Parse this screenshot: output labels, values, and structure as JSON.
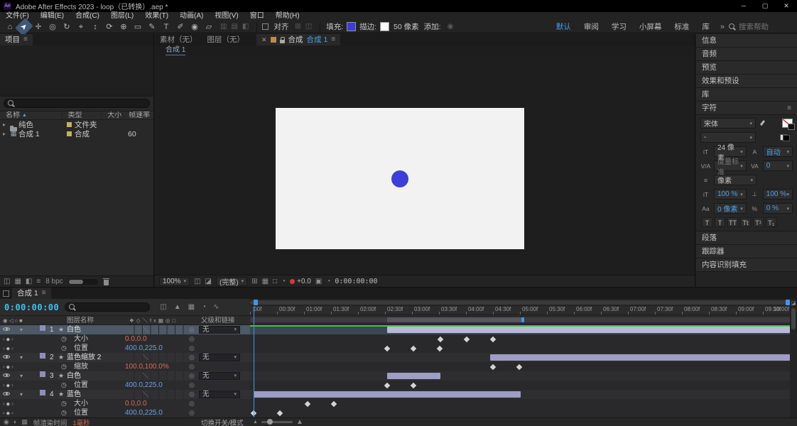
{
  "colors": {
    "accent": "#4096ee",
    "timecode_cyan": "#3fc1f2",
    "fill_swatch": "#3c3cd9",
    "shape_circle": "#3e3ed8",
    "composition_bg": "#f2f2f2",
    "value_red": "#dd6a55",
    "value_blue": "#6e9fe8",
    "cache_green": "#46c246",
    "layer_bar": "#9d9dc6"
  },
  "icons": {
    "hamburger": "≡",
    "minimize": "─",
    "maximize": "▢",
    "close": "✕",
    "dropdown": "▾",
    "disclosure": "▸",
    "expand": "▾",
    "sort_asc": "▲",
    "star": "★",
    "pickwhip": "◎",
    "stopwatch": "◷",
    "keyframe": "◆",
    "prev_key": "‹",
    "next_key": "›",
    "quality": "＼",
    "comp_item": "▦",
    "overflow": "»",
    "add_bullet": "◉",
    "av_header": "◉ ◁ ○ ■",
    "switches_header": "❖◇＼fx▦◎□"
  },
  "window": {
    "logo_text": "Ae",
    "title": "Adobe After Effects 2023 - loop（已转换）.aep *"
  },
  "menu_bar": {
    "items": [
      "文件(F)",
      "编辑(E)",
      "合成(C)",
      "图层(L)",
      "效果(T)",
      "动画(A)",
      "视图(V)",
      "窗口",
      "帮助(H)"
    ]
  },
  "toolbar": {
    "tools": [
      {
        "name": "home-tool",
        "glyph": "⌂"
      },
      {
        "name": "selection-tool",
        "glyph": "➤",
        "active": true
      },
      {
        "name": "hand-tool",
        "glyph": "✛"
      },
      {
        "name": "zoom-tool",
        "glyph": "◎"
      },
      {
        "name": "orbit-camera-tool",
        "glyph": "↻"
      },
      {
        "name": "pan-camera-tool",
        "glyph": "⌖"
      },
      {
        "name": "dolly-camera-tool",
        "glyph": "↕"
      },
      {
        "name": "rotation-tool",
        "glyph": "⟳"
      },
      {
        "name": "pan-behind-tool",
        "glyph": "⊕"
      },
      {
        "name": "shape-tool",
        "glyph": "▭"
      },
      {
        "name": "pen-tool",
        "glyph": "✎"
      },
      {
        "name": "type-tool",
        "glyph": "T"
      },
      {
        "name": "brush-tool",
        "glyph": "✐"
      },
      {
        "name": "clone-stamp-tool",
        "glyph": "◉"
      },
      {
        "name": "eraser-tool",
        "glyph": "▱"
      }
    ],
    "dim_tools": [
      "▥",
      "▤",
      "◧"
    ],
    "snap_label": "对齐",
    "snap_icons": [
      "⊞",
      "◫"
    ],
    "fill_label": "填充:",
    "stroke_label": "描边:",
    "stroke_width": "50 像素",
    "add_label": "添加:",
    "workspaces": [
      {
        "key": "default",
        "label": "默认",
        "active": true
      },
      {
        "key": "review",
        "label": "审阅"
      },
      {
        "key": "learn",
        "label": "学习"
      },
      {
        "key": "small-screen",
        "label": "小屏幕"
      },
      {
        "key": "standard",
        "label": "标准"
      },
      {
        "key": "libraries",
        "label": "库"
      }
    ],
    "search_placeholder": "搜索帮助"
  },
  "project_panel": {
    "tab_label": "项目",
    "columns": [
      "名称",
      "类型",
      "大小",
      "帧速率"
    ],
    "rows": [
      {
        "name": "纯色",
        "type": "文件夹",
        "size": "",
        "frame_rate": "",
        "icon": "folder"
      },
      {
        "name": "合成 1",
        "type": "合成",
        "size": "",
        "frame_rate": "60",
        "icon": "comp"
      }
    ],
    "bit_depth": "8 bpc",
    "bottom_icons": [
      "◫",
      "▦",
      "◧",
      "≡"
    ]
  },
  "viewer": {
    "tabs_inactive": [
      "素材（无）",
      "图层（无）"
    ],
    "tab": {
      "close": "✕",
      "panel_label": "合成",
      "comp_label": "合成 1"
    },
    "breadcrumb": "合成 1",
    "zoom": "100%",
    "resolution": "(完整)",
    "exposure": "+0.0",
    "timecode": "0:00:00:00",
    "icons_a": [
      "◫",
      "◪"
    ],
    "icons_b": [
      "⊞",
      "▦",
      "□",
      "◔"
    ],
    "icons_c": [
      "▣",
      "◔"
    ]
  },
  "right_panel": {
    "panels_above": [
      {
        "key": "info",
        "label": "信息"
      },
      {
        "key": "audio",
        "label": "音频"
      },
      {
        "key": "preview",
        "label": "预览"
      },
      {
        "key": "effects-presets",
        "label": "效果和预设"
      },
      {
        "key": "libraries",
        "label": "库"
      }
    ],
    "character": {
      "title": "字符",
      "font_family": "宋体",
      "font_style": "-",
      "font_size": "24 像素",
      "leading": "自动",
      "kerning": "度量标准",
      "tracking": "0",
      "unit_value": "像素",
      "vertical_scale": "100 %",
      "horizontal_scale": "100 %",
      "baseline_shift": "0 像素",
      "proportional_spacing": "0 %",
      "t_buttons": [
        "T",
        "T",
        "TT",
        "Tt",
        "T¹",
        "T₁"
      ]
    },
    "char_icons": [
      "iT",
      "A",
      "V/A",
      "VA",
      "≡",
      "iT",
      "⊥",
      "Aa",
      "%"
    ],
    "panels_below": [
      {
        "key": "paragraph",
        "label": "段落"
      },
      {
        "key": "tracker",
        "label": "跟踪器"
      },
      {
        "key": "content-aware-fill",
        "label": "内容识别填充"
      }
    ]
  },
  "timeline": {
    "tab_label": "合成 1",
    "timecode": "0:00:00:00",
    "control_icons": [
      "◫",
      "▲",
      "▦",
      "◔",
      "∿"
    ],
    "headers": {
      "layer_name": "图层名称",
      "parent": "父级和链接"
    },
    "ruler_ticks": [
      ":00f",
      "00:30f",
      "01:00f",
      "01:30f",
      "02:00f",
      "02:30f",
      "03:00f",
      "03:30f",
      "04:00f",
      "04:30f",
      "05:00f",
      "05:30f",
      "06:00f",
      "06:30f",
      "07:00f",
      "07:30f",
      "08:00f",
      "08:30f",
      "09:00f",
      "09:30f",
      "10:00f"
    ],
    "cti_percent": 0.66,
    "work_area": {
      "start": 25.4,
      "end": 50.2
    },
    "rows": [
      {
        "kind": "layer",
        "num": "1",
        "name": "白色",
        "parent": "无",
        "selected": true,
        "bar": {
          "start": 25.4,
          "end": 100
        }
      },
      {
        "kind": "prop",
        "name": "大小",
        "value": "0.0,0.0",
        "value_color": "#dd6a55",
        "keys": [
          35.3,
          40.1,
          45.0
        ]
      },
      {
        "kind": "prop",
        "name": "位置",
        "value": "400.0,225.0",
        "value_color": "#6e9fe8",
        "keys": [
          25.4,
          30.3,
          35.1
        ]
      },
      {
        "kind": "layer",
        "num": "2",
        "name": "蓝色缩放 2",
        "parent": "无",
        "bar": {
          "start": 44.5,
          "end": 100
        }
      },
      {
        "kind": "prop",
        "name": "缩放",
        "value": "100.0,100.0%",
        "value_color": "#dd6a55",
        "keys": [
          45.0,
          49.9
        ]
      },
      {
        "kind": "layer",
        "num": "3",
        "name": "白色",
        "parent": "无",
        "bar": {
          "start": 25.4,
          "end": 35.3
        }
      },
      {
        "kind": "prop",
        "name": "位置",
        "value": "400.0,225.0",
        "value_color": "#6e9fe8",
        "keys": [
          25.4,
          30.3
        ]
      },
      {
        "kind": "layer",
        "num": "4",
        "name": "蓝色",
        "parent": "无",
        "bar": {
          "start": 0.66,
          "end": 50.1
        }
      },
      {
        "kind": "prop",
        "name": "大小",
        "value": "0.0,0.0",
        "value_color": "#dd6a55",
        "keys": [
          10.7,
          15.5
        ]
      },
      {
        "kind": "prop",
        "name": "位置",
        "value": "400.0,225.0",
        "value_color": "#6e9fe8",
        "keys": [
          0.66,
          5.5
        ]
      }
    ],
    "status": {
      "render_label": "帧渲染时间",
      "render_value": "1毫秒",
      "toggle_label": "切换开关/模式"
    },
    "status_icons": [
      "◉",
      "◐",
      "▦"
    ]
  }
}
